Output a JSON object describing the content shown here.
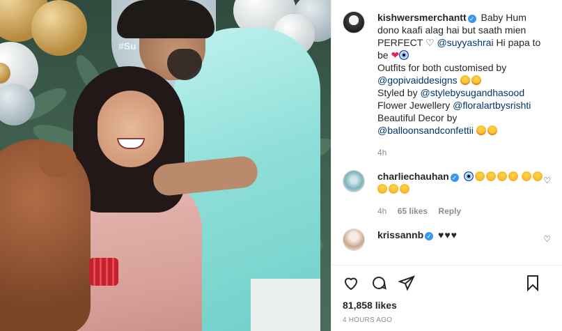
{
  "post": {
    "author": "kishwersmerchantt",
    "caption_intro": "Baby Hum dono kaafi alag hai but saath mien PERFECT",
    "caption_mention_1": "@suyyashrai",
    "caption_hi_papa": "Hi papa to be",
    "outfits_label": "Outfits for both customised by",
    "outfits_mention": "@gopivaiddesigns",
    "styled_label": "Styled by",
    "styled_mention": "@stylebysugandhasood",
    "flower_label": "Flower Jewellery",
    "flower_mention": "@floralartbysrishti",
    "decor_label": "Beautiful Decor by",
    "decor_mention": "@balloonsandconfettii",
    "time_ago": "4h",
    "image_overlay_text": "#Su"
  },
  "comments": [
    {
      "user": "charliechauhan",
      "time": "4h",
      "likes": "65 likes",
      "reply": "Reply"
    },
    {
      "user": "krissannb",
      "text": "♥♥♥"
    }
  ],
  "footer": {
    "likes": "81,858 likes",
    "timestamp": "4 HOURS AGO"
  },
  "icons": {
    "like": "heart-outline-icon",
    "comment": "comment-bubble-icon",
    "share": "paper-plane-icon",
    "save": "bookmark-icon",
    "verified": "verified-badge-icon"
  },
  "colors": {
    "mention": "#00376b",
    "verified": "#3897f0",
    "muted": "#8e8e8e",
    "text": "#262626"
  }
}
